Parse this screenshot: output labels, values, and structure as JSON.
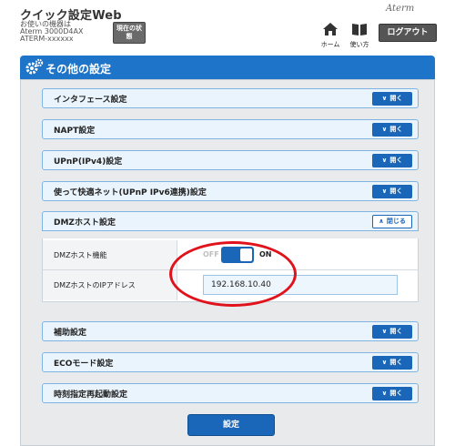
{
  "header": {
    "app_title": "クイック設定Web",
    "device_label": "お使いの機器は",
    "device_model": "Aterm 3000D4AX",
    "device_id": "ATERM-xxxxxx",
    "status_button": "現在の状態",
    "home_label": "ホーム",
    "manual_label": "使い方",
    "brand": "Aterm",
    "logout_label": "ログアウト"
  },
  "section": {
    "title": "その他の設定"
  },
  "accordions": [
    {
      "label": "インタフェース設定",
      "toggle": "開く"
    },
    {
      "label": "NAPT設定",
      "toggle": "開く"
    },
    {
      "label": "UPnP(IPv4)設定",
      "toggle": "開く"
    },
    {
      "label": "使って快適ネット(UPnP IPv6連携)設定",
      "toggle": "開く"
    },
    {
      "label": "DMZホスト設定",
      "toggle": "閉じる"
    },
    {
      "label": "補助設定",
      "toggle": "開く"
    },
    {
      "label": "ECOモード設定",
      "toggle": "開く"
    },
    {
      "label": "時刻指定再起動設定",
      "toggle": "開く"
    }
  ],
  "dmz": {
    "function_label": "DMZホスト機能",
    "off_label": "OFF",
    "on_label": "ON",
    "ip_label": "DMZホストのIPアドレス",
    "ip_value": "192.168.10.40"
  },
  "submit_label": "設定",
  "colors": {
    "accent": "#1a66b8",
    "banner": "#1d74c9",
    "annotation": "#e0121b"
  }
}
